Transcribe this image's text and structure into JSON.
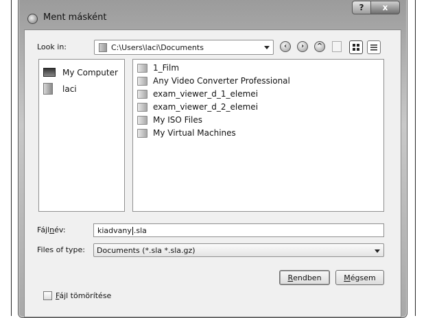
{
  "window": {
    "title": "Ment másként",
    "help_button": "?",
    "close_button": "x"
  },
  "look_in": {
    "label": "Look in:",
    "path": "C:\\Users\\laci\\Documents"
  },
  "toolbar": {
    "icons": [
      "back-icon",
      "forward-icon",
      "up-icon",
      "new-folder-icon",
      "detail-view-icon",
      "list-view-icon"
    ]
  },
  "places": [
    {
      "label": "My Computer",
      "icon": "computer-icon"
    },
    {
      "label": "laci",
      "icon": "user-folder-icon"
    }
  ],
  "files": [
    "1_Film",
    "Any Video Converter Professional",
    "exam_viewer_d_1_elemei",
    "exam_viewer_d_2_elemei",
    "My ISO Files",
    "My Virtual Machines"
  ],
  "filename": {
    "label_pre": "Fájl",
    "label_ul": "n",
    "label_post": "év:",
    "value_before_caret": "kiadvany",
    "value_after_caret": ".sla"
  },
  "filetype": {
    "label": "Files of type:",
    "value": "Documents (*.sla *.sla.gz)"
  },
  "buttons": {
    "ok_ul": "R",
    "ok_rest": "endben",
    "cancel_ul": "M",
    "cancel_rest": "égsem"
  },
  "compress": {
    "label_ul": "F",
    "label_rest": "ájl tömörítése",
    "checked": false
  }
}
